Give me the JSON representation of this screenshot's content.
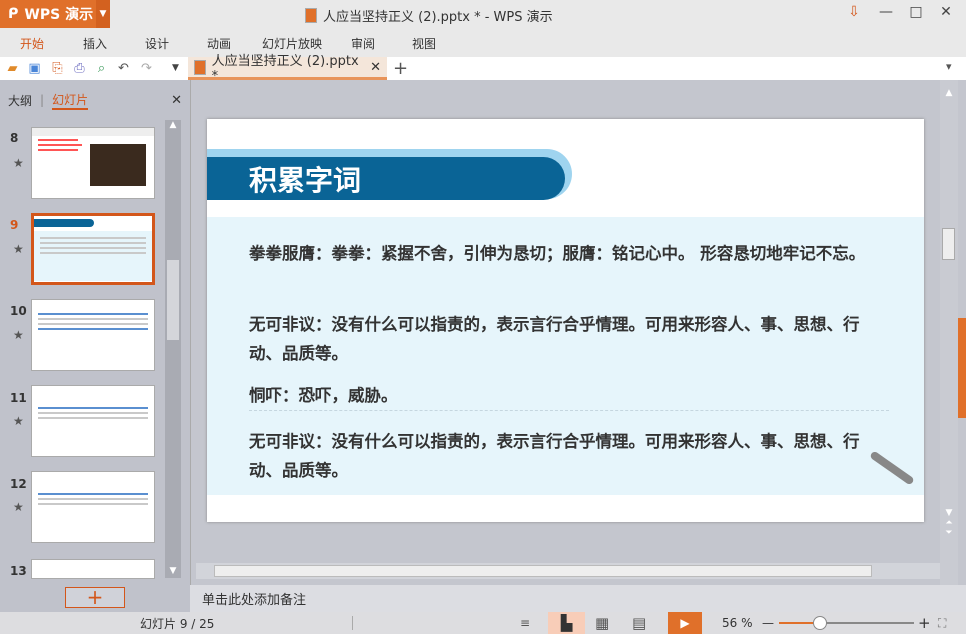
{
  "app": {
    "logo_label": "WPS 演示",
    "window_title": "人应当坚持正义 (2).pptx * - WPS 演示"
  },
  "ribbon_tabs": [
    "开始",
    "插入",
    "设计",
    "动画",
    "幻灯片放映",
    "审阅",
    "视图"
  ],
  "active_tab": "开始",
  "doc_tab": {
    "label": "人应当坚持正义 (2).pptx *"
  },
  "left_panel": {
    "tab_outline": "大纲",
    "tab_slides": "幻灯片",
    "thumb_numbers": [
      "8",
      "9",
      "10",
      "11",
      "12",
      "13"
    ],
    "selected": "9"
  },
  "slide": {
    "title": "积累字词",
    "paragraphs": [
      "拳拳服膺：拳拳：紧握不舍，引伸为恳切；服膺：铭记心中。 形容恳切地牢记不忘。",
      "无可非议：没有什么可以指责的，表示言行合乎情理。可用来形容人、事、思想、行动、品质等。",
      "恫吓：恐吓，威胁。",
      "无可非议：没有什么可以指责的，表示言行合乎情理。可用来形容人、事、思想、行动、品质等。"
    ]
  },
  "notes_placeholder": "单击此处添加备注",
  "status": {
    "slide_counter": "幻灯片 9 / 25",
    "zoom": "56 %",
    "zoom_fraction": 0.3
  },
  "colors": {
    "accent": "#e0702a",
    "title_band": "#0a6496"
  }
}
